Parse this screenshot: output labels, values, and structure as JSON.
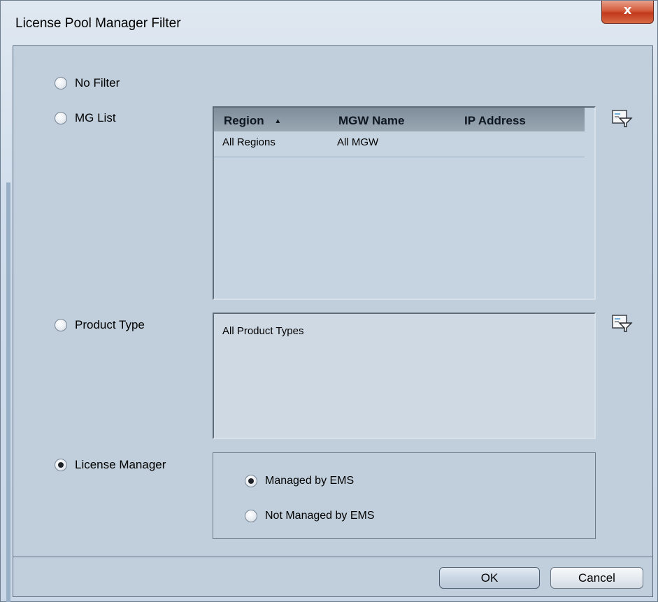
{
  "window": {
    "title": "License Pool Manager Filter",
    "close_glyph": "x"
  },
  "filters": {
    "no_filter_label": "No Filter",
    "mg_list_label": "MG List",
    "product_type_label": "Product Type",
    "license_manager_label": "License Manager",
    "selected": "License Manager"
  },
  "mg_table": {
    "columns": [
      "Region",
      "MGW Name",
      "IP Address"
    ],
    "sort_indicator": "▲",
    "rows": [
      {
        "region": "All Regions",
        "mgw_name": "All MGW",
        "ip_address": ""
      }
    ]
  },
  "product_types": {
    "items": [
      "All Product Types"
    ]
  },
  "license_manager_options": {
    "managed_label": "Managed by EMS",
    "not_managed_label": "Not Managed by EMS",
    "selected": "Managed by EMS"
  },
  "buttons": {
    "ok_label": "OK",
    "cancel_label": "Cancel"
  },
  "icons": {
    "filter_edit": "filter-edit-icon"
  }
}
